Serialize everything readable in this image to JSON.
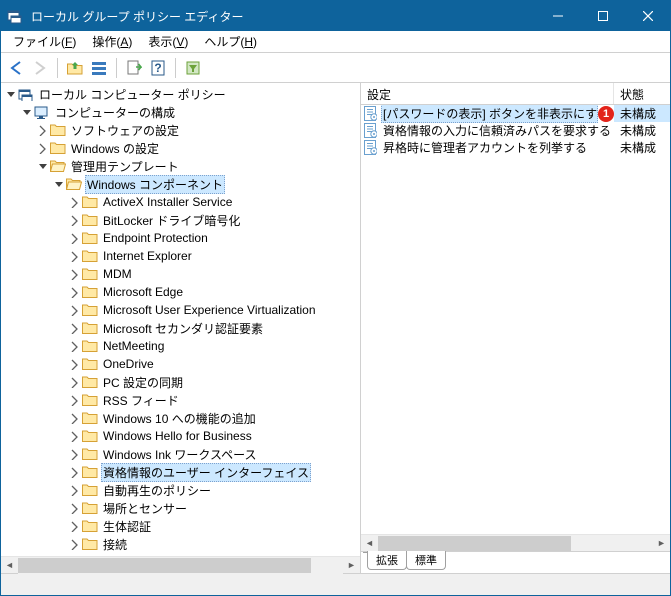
{
  "window": {
    "title": "ローカル グループ ポリシー エディター"
  },
  "menu": {
    "file": "ファイル(<u>F</u>)",
    "action": "操作(<u>A</u>)",
    "view": "表示(<u>V</u>)",
    "help": "ヘルプ(<u>H</u>)"
  },
  "toolbar": {
    "back": "back-icon",
    "forward": "forward-icon",
    "up": "up-icon",
    "list": "list-icon",
    "export": "export-icon",
    "help": "help-icon",
    "filter": "filter-icon"
  },
  "tree": {
    "root": "ローカル コンピューター ポリシー",
    "computer_config": "コンピューターの構成",
    "software": "ソフトウェアの設定",
    "windows_settings": "Windows の設定",
    "admin_templates": "管理用テンプレート",
    "win_components": "Windows コンポーネント",
    "items": [
      "ActiveX Installer Service",
      "BitLocker ドライブ暗号化",
      "Endpoint Protection",
      "Internet Explorer",
      "MDM",
      "Microsoft Edge",
      "Microsoft User Experience Virtualization",
      "Microsoft セカンダリ認証要素",
      "NetMeeting",
      "OneDrive",
      "PC 設定の同期",
      "RSS フィード",
      "Windows 10 への機能の追加",
      "Windows Hello for Business",
      "Windows Ink ワークスペース",
      "資格情報のユーザー インターフェイス",
      "自動再生のポリシー",
      "場所とセンサー",
      "生体認証",
      "接続"
    ],
    "selected_index": 15
  },
  "list": {
    "header_setting": "設定",
    "header_state": "状態",
    "rows": [
      {
        "text": "[パスワードの表示] ボタンを非表示にする",
        "state": "未構成",
        "badge": "1",
        "selected": true
      },
      {
        "text": "資格情報の入力に信頼済みパスを要求する",
        "state": "未構成",
        "badge": null,
        "selected": false
      },
      {
        "text": "昇格時に管理者アカウントを列挙する",
        "state": "未構成",
        "badge": null,
        "selected": false
      }
    ]
  },
  "tabs": {
    "extended": "拡張",
    "standard": "標準"
  }
}
